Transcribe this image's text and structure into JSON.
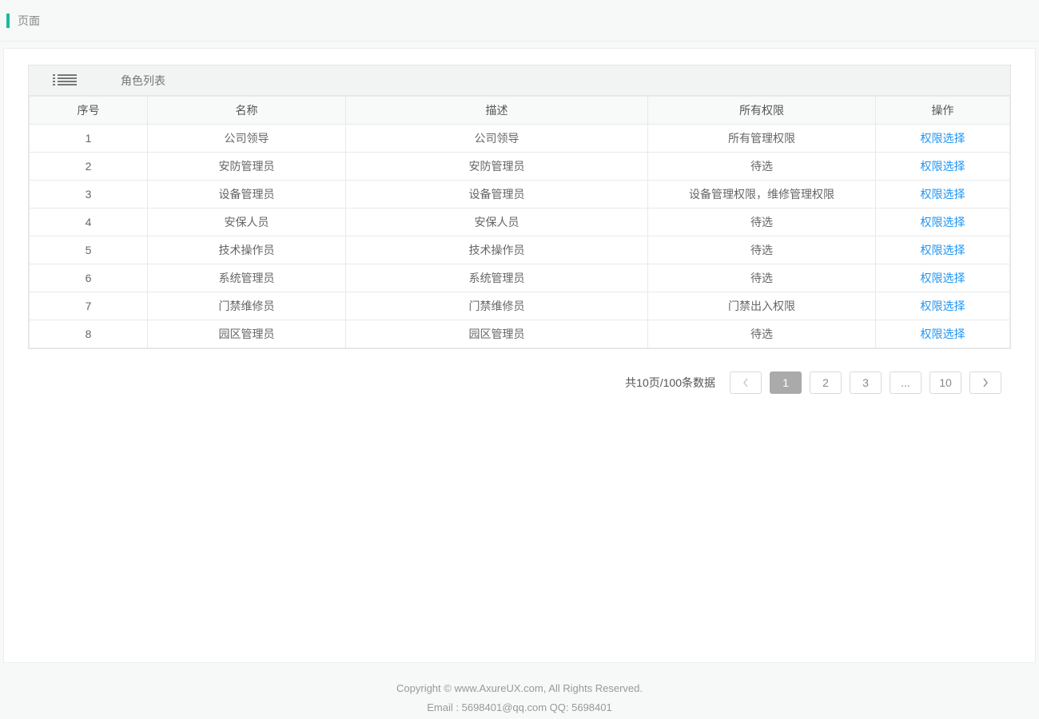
{
  "header": {
    "title": "页面"
  },
  "panel": {
    "title": "角色列表"
  },
  "table": {
    "headers": {
      "index": "序号",
      "name": "名称",
      "desc": "描述",
      "perm": "所有权限",
      "action": "操作"
    },
    "rows": [
      {
        "idx": "1",
        "name": "公司领导",
        "desc": "公司领导",
        "perm": "所有管理权限",
        "action": "权限选择"
      },
      {
        "idx": "2",
        "name": "安防管理员",
        "desc": "安防管理员",
        "perm": "待选",
        "action": "权限选择"
      },
      {
        "idx": "3",
        "name": "设备管理员",
        "desc": "设备管理员",
        "perm": "设备管理权限，维修管理权限",
        "action": "权限选择"
      },
      {
        "idx": "4",
        "name": "安保人员",
        "desc": "安保人员",
        "perm": "待选",
        "action": "权限选择"
      },
      {
        "idx": "5",
        "name": "技术操作员",
        "desc": "技术操作员",
        "perm": "待选",
        "action": "权限选择"
      },
      {
        "idx": "6",
        "name": "系统管理员",
        "desc": "系统管理员",
        "perm": "待选",
        "action": "权限选择"
      },
      {
        "idx": "7",
        "name": "门禁维修员",
        "desc": "门禁维修员",
        "perm": "门禁出入权限",
        "action": "权限选择"
      },
      {
        "idx": "8",
        "name": "园区管理员",
        "desc": "园区管理员",
        "perm": "待选",
        "action": "权限选择"
      }
    ]
  },
  "pagination": {
    "info": "共10页/100条数据",
    "pages": {
      "p1": "1",
      "p2": "2",
      "p3": "3",
      "ellipsis": "...",
      "last": "10"
    }
  },
  "footer": {
    "line1": "Copyright © www.AxureUX.com, All Rights Reserved.",
    "line2": "Email : 5698401@qq.com  QQ: 5698401"
  }
}
